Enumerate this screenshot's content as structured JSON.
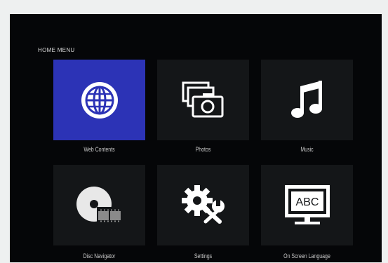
{
  "menu": {
    "title": "HOME MENU",
    "items": [
      {
        "label": "Web Contents",
        "icon": "globe-icon",
        "selected": true
      },
      {
        "label": "Photos",
        "icon": "photos-icon",
        "selected": false
      },
      {
        "label": "Music",
        "icon": "music-note-icon",
        "selected": false
      },
      {
        "label": "Disc Navigator",
        "icon": "disc-icon",
        "selected": false
      },
      {
        "label": "Settings",
        "icon": "gear-wrench-icon",
        "selected": false
      },
      {
        "label": "On Screen Language",
        "icon": "tv-abc-icon",
        "selected": false
      }
    ],
    "abc_text": "ABC"
  },
  "colors": {
    "background": "#050608",
    "tile": "#141618",
    "selected_tile": "#2c33b6",
    "text": "#c9c9c9"
  }
}
